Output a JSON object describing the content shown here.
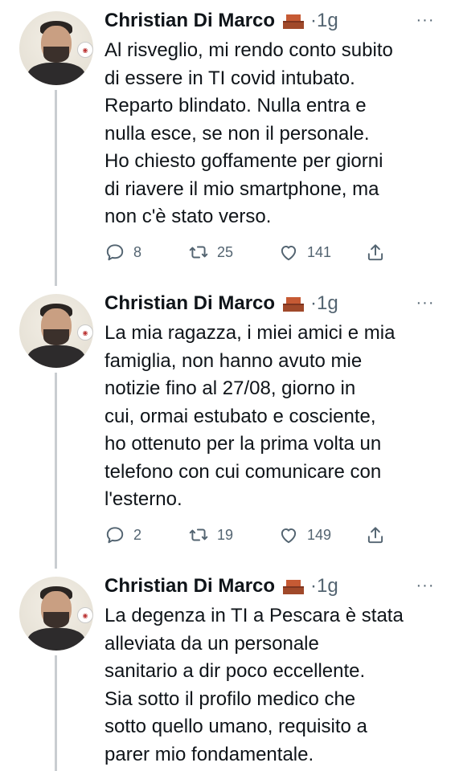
{
  "tweets": [
    {
      "author": "Christian Di Marco",
      "time": "·1g",
      "more": "···",
      "text": "Al risveglio, mi rendo conto subito\ndi essere in TI covid intubato.\nReparto blindato. Nulla entra e\nnulla esce, se non il personale.\nHo chiesto goffamente per giorni\ndi riavere il mio smartphone, ma\nnon c'è stato verso.",
      "replies": "8",
      "retweets": "25",
      "likes": "141"
    },
    {
      "author": "Christian Di Marco",
      "time": "·1g",
      "more": "···",
      "text": "La mia ragazza, i miei amici e mia\nfamiglia, non hanno avuto mie\nnotizie fino al 27/08, giorno in\ncui, ormai estubato e cosciente,\nho ottenuto per la prima volta un\ntelefono con cui comunicare con\nl'esterno.",
      "replies": "2",
      "retweets": "19",
      "likes": "149"
    },
    {
      "author": "Christian Di Marco",
      "time": "·1g",
      "more": "···",
      "text": "La degenza in TI a Pescara è stata\nalleviata da un personale\nsanitario a dir poco eccellente.\nSia sotto il profilo medico che\nsotto quello umano, requisito a\nparer mio fondamentale."
    }
  ],
  "icons": {
    "reply": "reply-icon",
    "retweet": "retweet-icon",
    "like": "heart-icon",
    "share": "share-icon",
    "emoji": "bricks-emoji",
    "more": "more-icon"
  },
  "colors": {
    "text": "#0f1419",
    "secondary": "#536471",
    "thread_line": "#c9cdd1"
  }
}
